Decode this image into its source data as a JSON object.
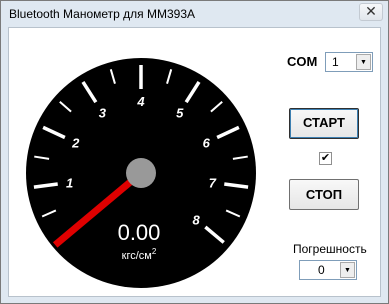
{
  "window": {
    "title": "Bluetooth Манометр для MM393A",
    "close_glyph": "✕"
  },
  "com": {
    "label": "COM",
    "value": "1"
  },
  "buttons": {
    "start": "СТАРТ",
    "stop": "СТОП"
  },
  "checkbox": {
    "checked": true,
    "glyph": "✔"
  },
  "error": {
    "label": "Погрешность",
    "value": "0"
  },
  "gauge": {
    "value": 0.0,
    "value_text": "0.00",
    "unit_prefix": "кгс/см",
    "unit_power": "2",
    "scale_min": 0,
    "scale_max": 8,
    "tick_labels": [
      "1",
      "2",
      "3",
      "4",
      "5",
      "6",
      "7",
      "8"
    ],
    "colors": {
      "face": "#000000",
      "ticks": "#ffffff",
      "needle": "#e00000",
      "hub": "#999999"
    }
  },
  "icons": {
    "dropdown": "chevron-down-icon"
  }
}
